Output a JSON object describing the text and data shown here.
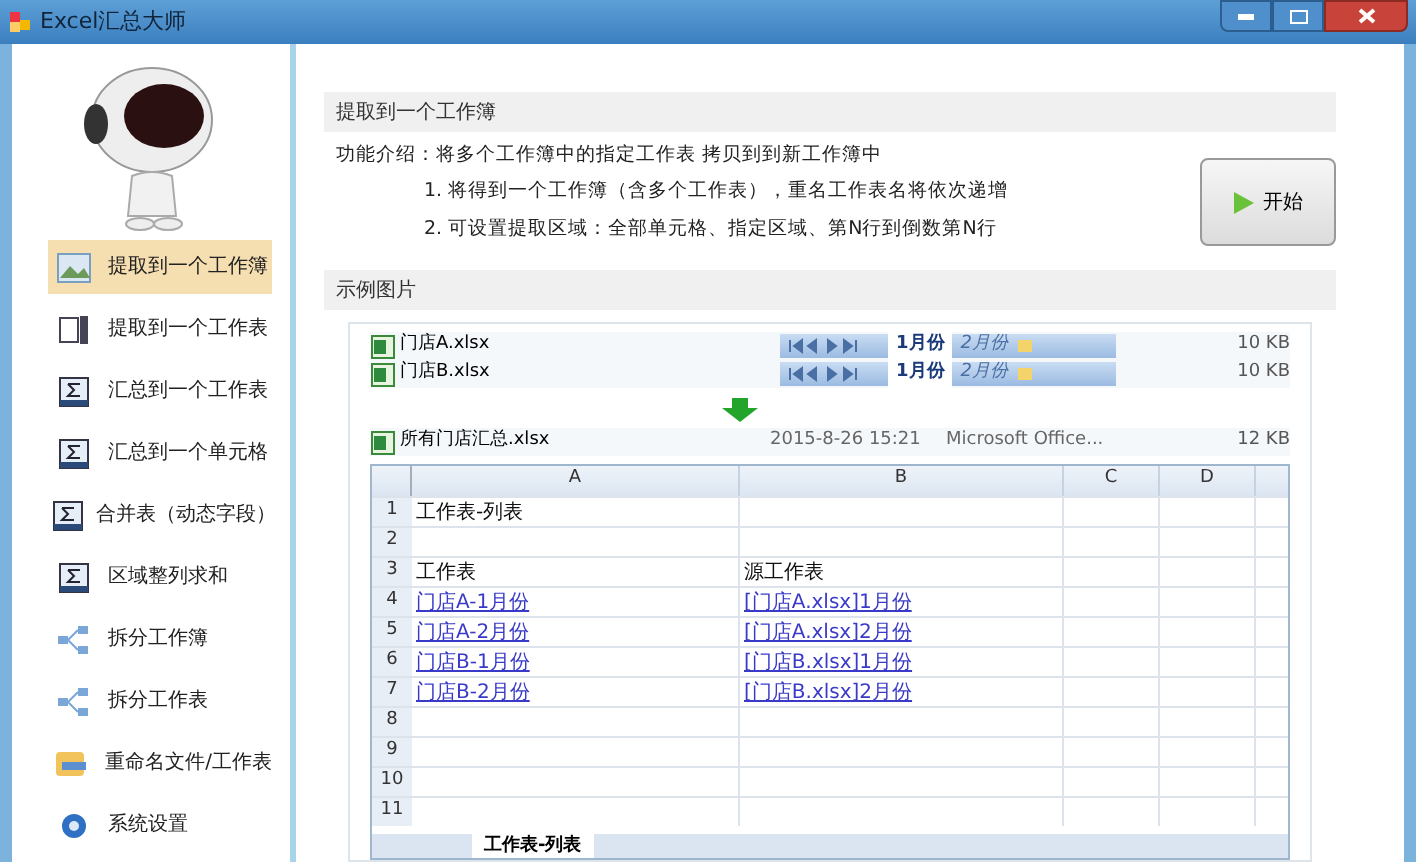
{
  "window": {
    "title": "Excel汇总大师"
  },
  "sidebar": {
    "items": [
      {
        "label": "提取到一个工作簿",
        "kind": "picture",
        "selected": true
      },
      {
        "label": "提取到一个工作表",
        "kind": "sheet",
        "selected": false
      },
      {
        "label": "汇总到一个工作表",
        "kind": "sum",
        "selected": false
      },
      {
        "label": "汇总到一个单元格",
        "kind": "sum",
        "selected": false
      },
      {
        "label": "合并表（动态字段）",
        "kind": "sum",
        "selected": false
      },
      {
        "label": "区域整列求和",
        "kind": "sum",
        "selected": false
      },
      {
        "label": "拆分工作簿",
        "kind": "split",
        "selected": false
      },
      {
        "label": "拆分工作表",
        "kind": "split",
        "selected": false
      },
      {
        "label": "重命名文件/工作表",
        "kind": "rename",
        "selected": false
      },
      {
        "label": "系统设置",
        "kind": "settings",
        "selected": false
      }
    ]
  },
  "main": {
    "title": "提取到一个工作簿",
    "intro": "功能介绍：将多个工作簿中的指定工作表 拷贝到到新工作簿中",
    "notes": [
      "1. 将得到一个工作簿（含多个工作表），重名工作表名将依次递增",
      "2. 可设置提取区域：全部单元格、指定区域、第N行到倒数第N行"
    ],
    "start_button": "开始",
    "example_title": "示例图片"
  },
  "example": {
    "source_files": [
      {
        "name": "门店A.xlsx",
        "sheet_tabs": [
          "1月份",
          "2月份"
        ],
        "size": "10 KB"
      },
      {
        "name": "门店B.xlsx",
        "sheet_tabs": [
          "1月份",
          "2月份"
        ],
        "size": "10 KB"
      }
    ],
    "result_file": {
      "name": "所有门店汇总.xlsx",
      "date": "2015-8-26 15:21",
      "type": "Microsoft Office...",
      "size": "12 KB"
    },
    "sheet": {
      "columns": [
        "A",
        "B",
        "C",
        "D"
      ],
      "rows": [
        {
          "number": "1",
          "cells": [
            {
              "text": "工作表-列表",
              "link": false
            }
          ]
        },
        {
          "number": "2"
        },
        {
          "number": "3",
          "cells": [
            {
              "text": "工作表",
              "link": false
            },
            {
              "text": "源工作表",
              "link": false
            }
          ]
        },
        {
          "number": "4",
          "cells": [
            {
              "text": "门店A-1月份",
              "link": true
            },
            {
              "text": "[门店A.xlsx]1月份",
              "link": true
            }
          ]
        },
        {
          "number": "5",
          "cells": [
            {
              "text": "门店A-2月份",
              "link": true
            },
            {
              "text": "[门店A.xlsx]2月份",
              "link": true
            }
          ]
        },
        {
          "number": "6",
          "cells": [
            {
              "text": "门店B-1月份",
              "link": true
            },
            {
              "text": "[门店B.xlsx]1月份",
              "link": true
            }
          ]
        },
        {
          "number": "7",
          "cells": [
            {
              "text": "门店B-2月份",
              "link": true
            },
            {
              "text": "[门店B.xlsx]2月份",
              "link": true
            }
          ]
        },
        {
          "number": "8"
        },
        {
          "number": "9"
        },
        {
          "number": "10"
        },
        {
          "number": "11"
        }
      ],
      "tabs": [
        {
          "label": "工作表-列表",
          "selected": true
        }
      ]
    }
  }
}
